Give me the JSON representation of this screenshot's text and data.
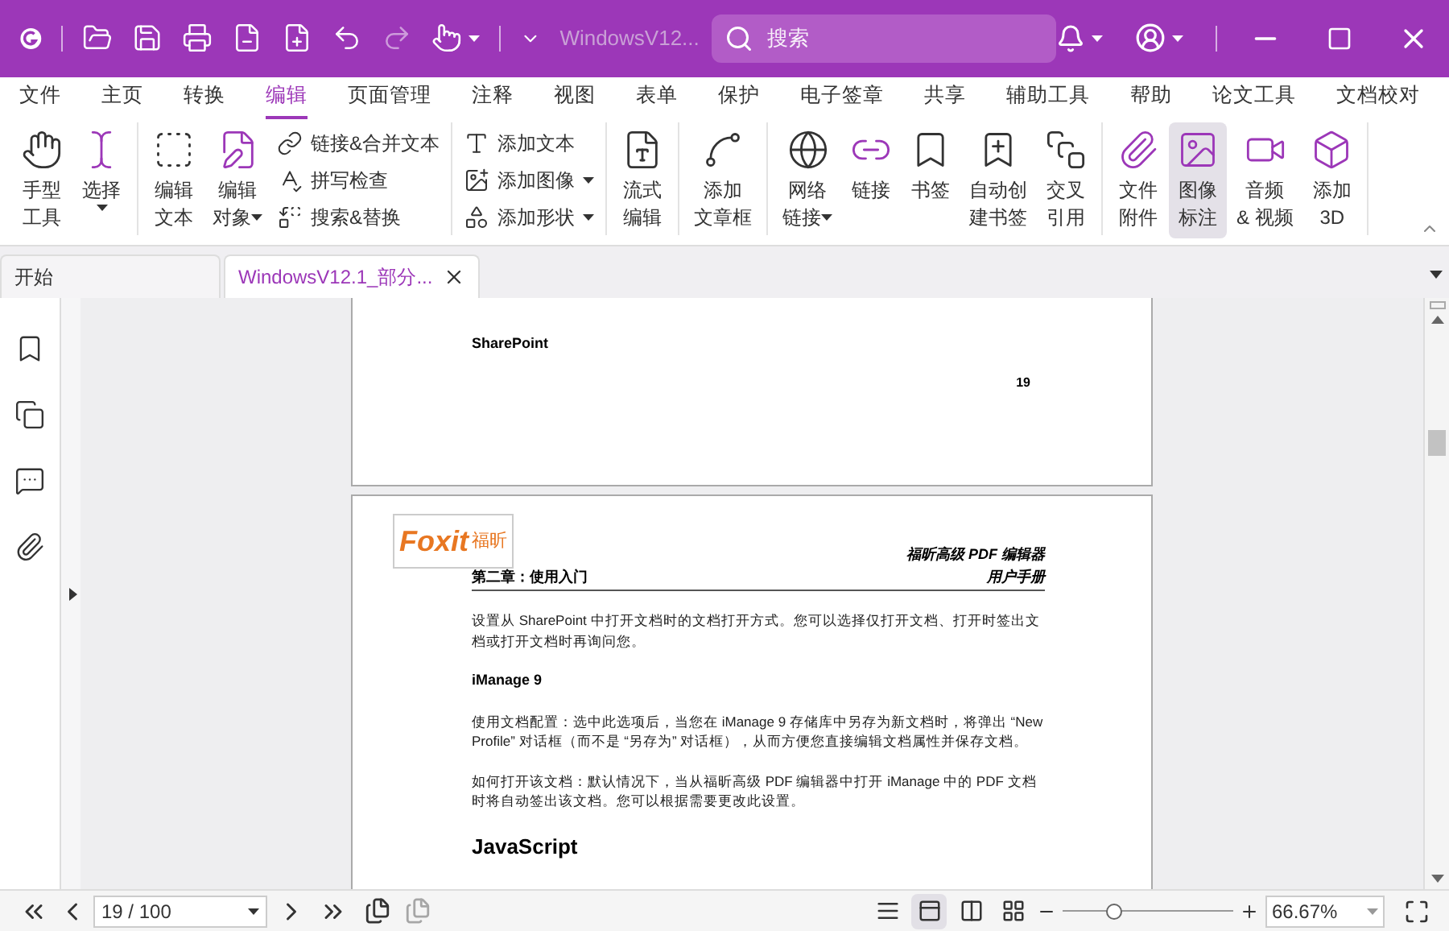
{
  "title_bar": {
    "file_name": "WindowsV12...",
    "search": {
      "placeholder": "搜索"
    }
  },
  "menu_tabs": [
    {
      "label": "文件",
      "selected": false
    },
    {
      "label": "主页",
      "selected": false
    },
    {
      "label": "转换",
      "selected": false
    },
    {
      "label": "编辑",
      "selected": true
    },
    {
      "label": "页面管理",
      "selected": false
    },
    {
      "label": "注释",
      "selected": false
    },
    {
      "label": "视图",
      "selected": false
    },
    {
      "label": "表单",
      "selected": false
    },
    {
      "label": "保护",
      "selected": false
    },
    {
      "label": "电子签章",
      "selected": false
    },
    {
      "label": "共享",
      "selected": false
    },
    {
      "label": "辅助工具",
      "selected": false
    },
    {
      "label": "帮助",
      "selected": false
    },
    {
      "label": "论文工具",
      "selected": false
    },
    {
      "label": "文档校对",
      "selected": false
    }
  ],
  "ribbon_groups": [
    {
      "items": [
        {
          "kind": "large",
          "lines": [
            "手型",
            "工具"
          ],
          "dropdown": false,
          "selected": false
        },
        {
          "kind": "large",
          "lines": [
            "选择"
          ],
          "dropdown": true,
          "selected": false
        }
      ]
    },
    {
      "items": [
        {
          "kind": "large",
          "lines": [
            "编辑",
            "文本"
          ],
          "dropdown": false,
          "selected": false
        },
        {
          "kind": "large",
          "lines": [
            "编辑",
            "对象"
          ],
          "dropdown": true,
          "selected": false
        },
        {
          "kind": "stack",
          "entries": [
            {
              "label": "链接&合并文本",
              "dropdown": false
            },
            {
              "label": "拼写检查",
              "dropdown": false
            },
            {
              "label": "搜索&替换",
              "dropdown": false
            }
          ]
        }
      ]
    },
    {
      "items": [
        {
          "kind": "stack",
          "entries": [
            {
              "label": "添加文本",
              "dropdown": false
            },
            {
              "label": "添加图像",
              "dropdown": true
            },
            {
              "label": "添加形状",
              "dropdown": true
            }
          ]
        }
      ]
    },
    {
      "items": [
        {
          "kind": "large",
          "lines": [
            "流式",
            "编辑"
          ],
          "dropdown": false,
          "selected": false
        }
      ]
    },
    {
      "items": [
        {
          "kind": "large",
          "lines": [
            "添加",
            "文章框"
          ],
          "dropdown": false,
          "selected": false
        }
      ]
    },
    {
      "items": [
        {
          "kind": "large",
          "lines": [
            "网络",
            "链接"
          ],
          "dropdown": true,
          "selected": false
        },
        {
          "kind": "large",
          "lines": [
            "链接"
          ],
          "dropdown": false,
          "selected": false
        },
        {
          "kind": "large",
          "lines": [
            "书签"
          ],
          "dropdown": false,
          "selected": false
        },
        {
          "kind": "large",
          "lines": [
            "自动创",
            "建书签"
          ],
          "dropdown": false,
          "selected": false
        },
        {
          "kind": "large",
          "lines": [
            "交叉",
            "引用"
          ],
          "dropdown": false,
          "selected": false
        }
      ]
    },
    {
      "items": [
        {
          "kind": "large",
          "lines": [
            "文件",
            "附件"
          ],
          "dropdown": false,
          "selected": false
        },
        {
          "kind": "large",
          "lines": [
            "图像",
            "标注"
          ],
          "dropdown": false,
          "selected": true
        },
        {
          "kind": "large",
          "lines": [
            "音频",
            "& 视频"
          ],
          "dropdown": false,
          "selected": false
        },
        {
          "kind": "large",
          "lines": [
            "添加",
            "3D"
          ],
          "dropdown": false,
          "selected": false
        }
      ]
    }
  ],
  "doc_tabs": [
    {
      "label": "开始",
      "selected": false,
      "closable": false
    },
    {
      "label": "WindowsV12.1_部分...",
      "selected": true,
      "closable": true
    }
  ],
  "page_prev": {
    "heading": "SharePoint",
    "page_number": "19"
  },
  "page_current": {
    "logo": {
      "wordmark": "Foxit",
      "chinese": "福昕"
    },
    "header_title": "福昕高级 PDF 编辑器",
    "header_subtitle": "用户手册",
    "chapter": "第二章：使用入门",
    "blocks": [
      {
        "kind": "para",
        "text": "设置从 SharePoint 中打开文档时的文档打开方式。您可以选择仅打开文档、打开时签出文档或打开文档时再询问您。"
      },
      {
        "kind": "subheading",
        "text": "iManage 9"
      },
      {
        "kind": "para",
        "text": "使用文档配置：选中此选项后，当您在 iManage 9 存储库中另存为新文档时，将弹出 “New Profile” 对话框（而不是 “另存为” 对话框），从而方便您直接编辑文档属性并保存文档。"
      },
      {
        "kind": "para",
        "text": "如何打开该文档：默认情况下，当从福昕高级 PDF 编辑器中打开 iManage 中的 PDF 文档时将自动签出该文档。您可以根据需要更改此设置。"
      },
      {
        "kind": "heading",
        "text": "JavaScript"
      }
    ]
  },
  "status_bar": {
    "page_field": "19 / 100",
    "view_modes": [
      {
        "selected": false
      },
      {
        "selected": true
      },
      {
        "selected": false
      },
      {
        "selected": false
      }
    ],
    "zoom_slider": {
      "level": 0.3
    },
    "zoom_value": "66.67%"
  }
}
